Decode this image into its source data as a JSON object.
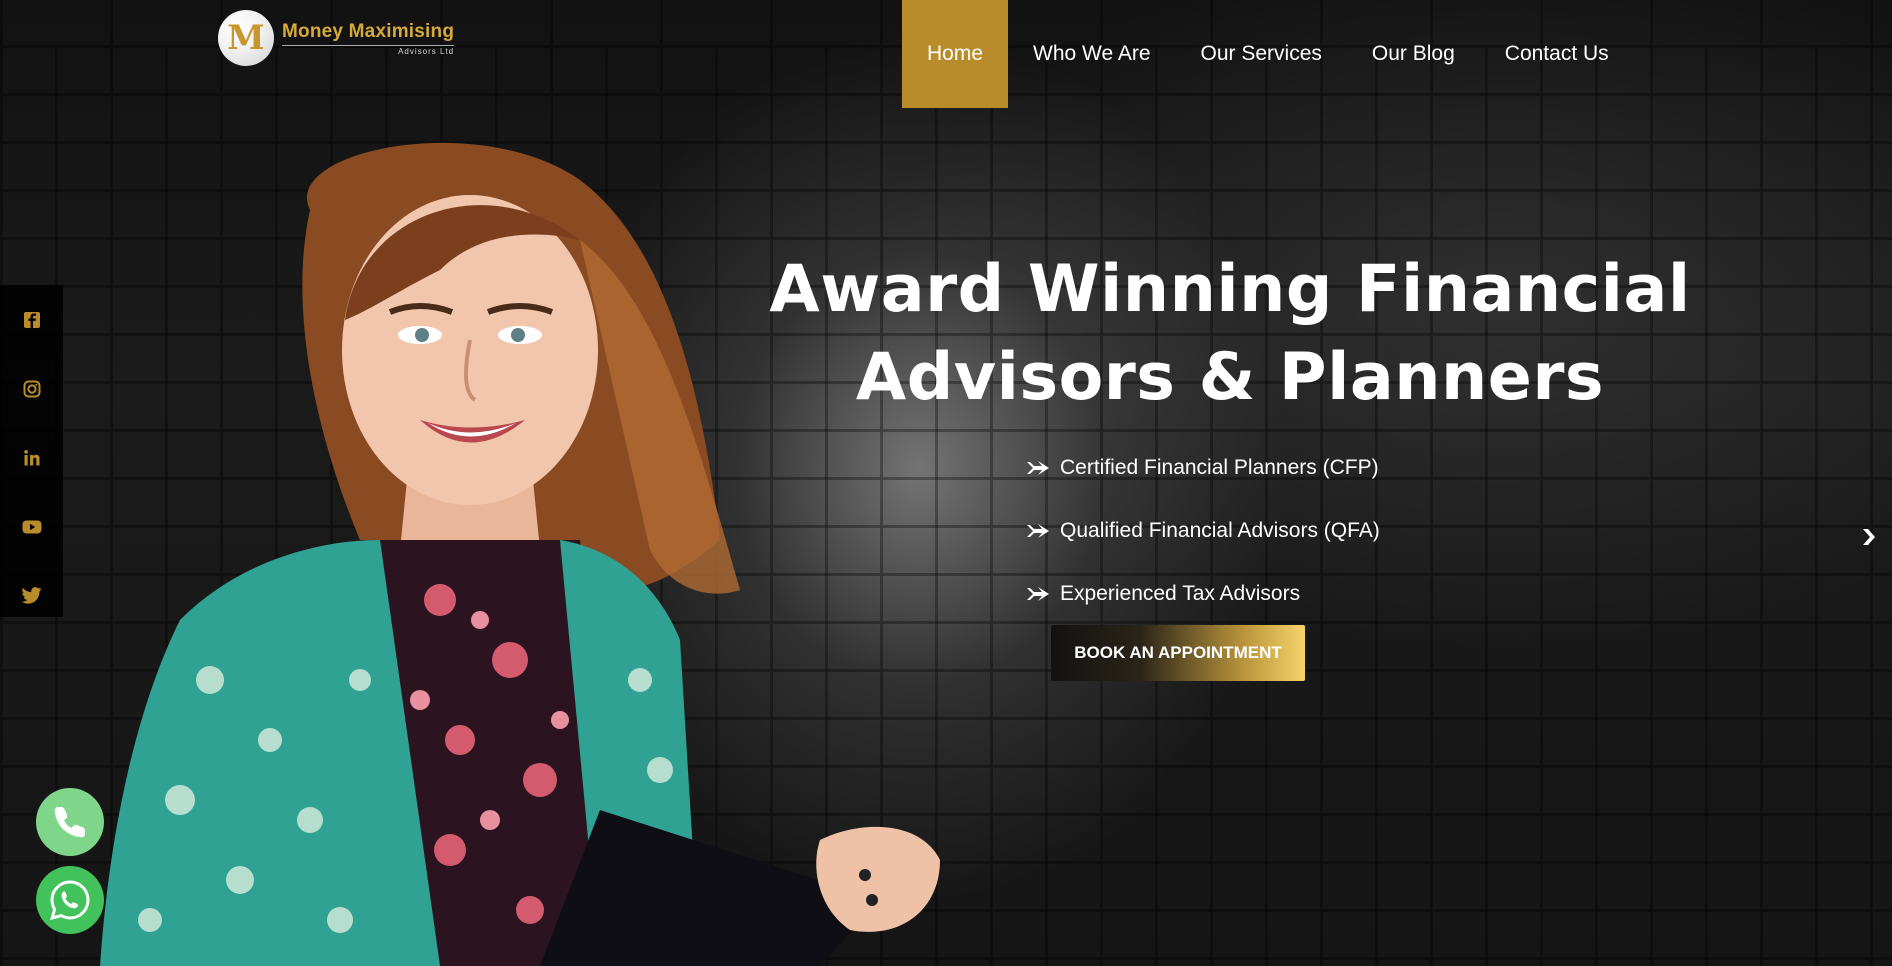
{
  "brand": {
    "logo_letter": "M",
    "name": "Money Maximising",
    "subtitle": "Advisors Ltd"
  },
  "nav": {
    "items": [
      {
        "label": "Home",
        "active": true
      },
      {
        "label": "Who We Are",
        "active": false
      },
      {
        "label": "Our Services",
        "active": false
      },
      {
        "label": "Our Blog",
        "active": false
      },
      {
        "label": "Contact Us",
        "active": false
      }
    ]
  },
  "social": {
    "icons": [
      "facebook-icon",
      "instagram-icon",
      "linkedin-icon",
      "youtube-icon",
      "twitter-icon"
    ],
    "color": "#b88c2b"
  },
  "hero": {
    "title_line1": "Award Winning Financial",
    "title_line2": "Advisors & Planners",
    "bullets": [
      "Certified Financial Planners (CFP)",
      "Qualified Financial Advisors (QFA)",
      "Experienced Tax Advisors"
    ],
    "cta_label": "BOOK AN APPOINTMENT"
  },
  "colors": {
    "accent": "#b88c2b",
    "phone_button": "#7fd68a",
    "whatsapp_button": "#41c25a"
  }
}
